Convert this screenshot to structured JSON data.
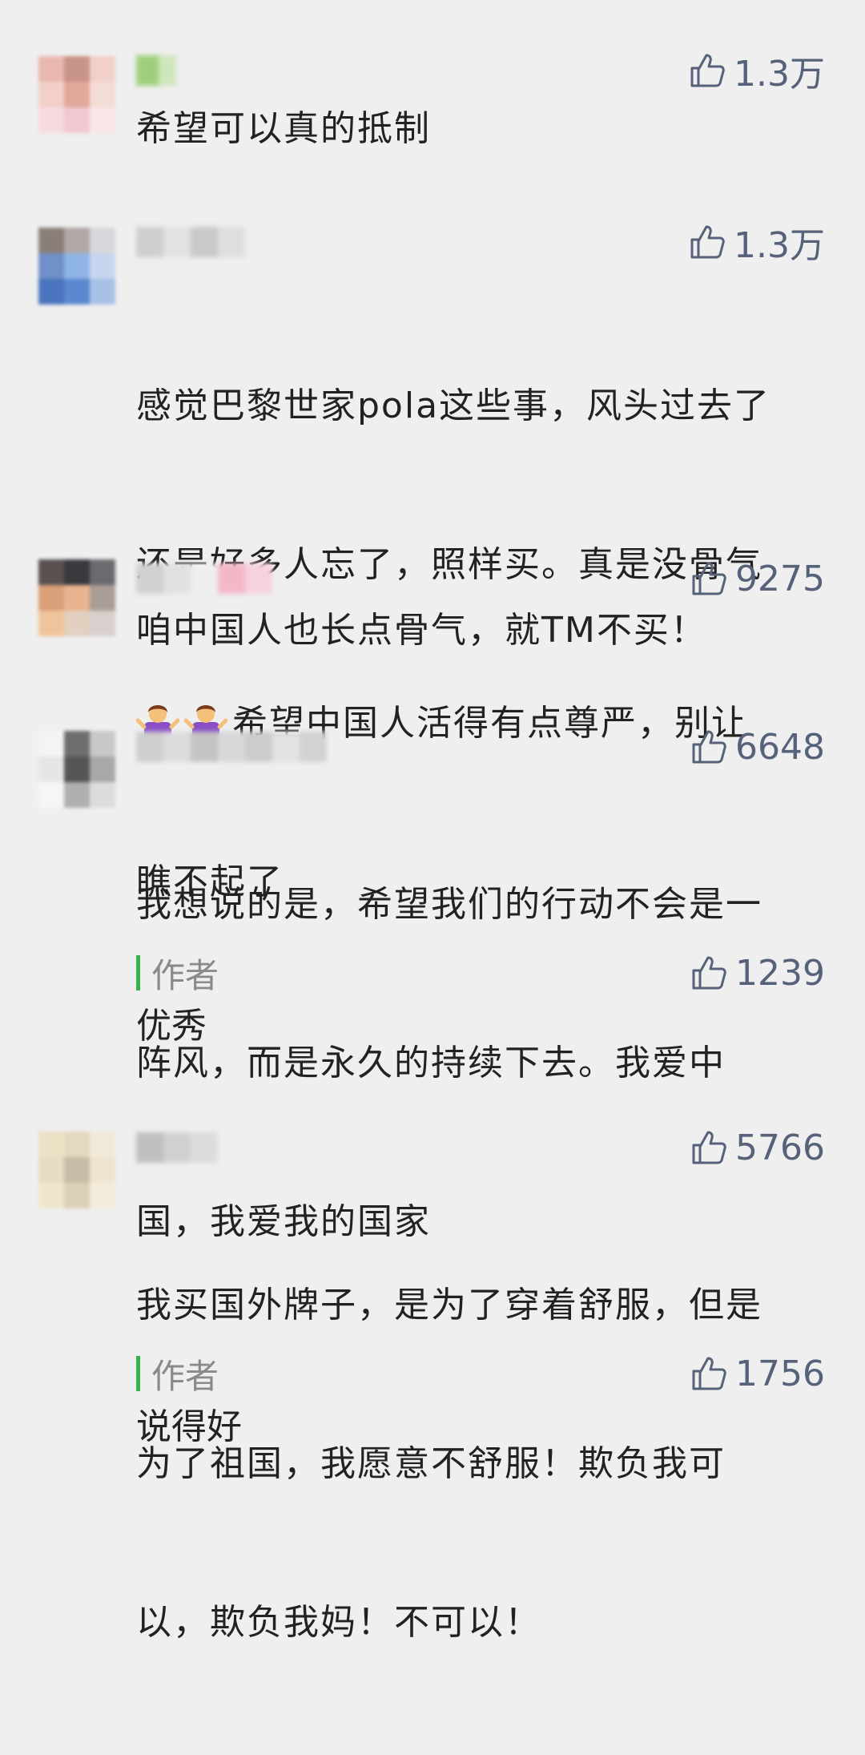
{
  "comments": [
    {
      "likes": "1.3万",
      "text": "希望可以真的抵制"
    },
    {
      "likes": "1.3万",
      "text_line1": "感觉巴黎世家pola这些事，风头过去了",
      "text_line2": "还是好多人忘了，照样买。真是没骨气",
      "text_line3_after_emoji": "希望中国人活得有点尊严，别让",
      "text_line4": "瞧不起了",
      "emoji": [
        "person-shrugging-emoji",
        "person-shrugging-emoji"
      ]
    },
    {
      "likes": "9275",
      "text": "咱中国人也长点骨气，就TM不买！"
    },
    {
      "likes": "6648",
      "text_line1": "我想说的是，希望我们的行动不会是一",
      "text_line2": "阵风，而是永久的持续下去。我爱中",
      "text_line3": "国，我爱我的国家",
      "reply": {
        "tag": "作者",
        "likes": "1239",
        "text": "优秀"
      }
    },
    {
      "likes": "5766",
      "text_line1": "我买国外牌子，是为了穿着舒服，但是",
      "text_line2": "为了祖国，我愿意不舒服！欺负我可",
      "text_line3": "以，欺负我妈！不可以！",
      "reply": {
        "tag": "作者",
        "likes": "1756",
        "text": "说得好"
      }
    }
  ],
  "colors": {
    "background": "#efefef",
    "like_color": "#56617a",
    "author_bar": "#37b24d"
  },
  "icons": {
    "like": "thumbs-up-icon"
  }
}
